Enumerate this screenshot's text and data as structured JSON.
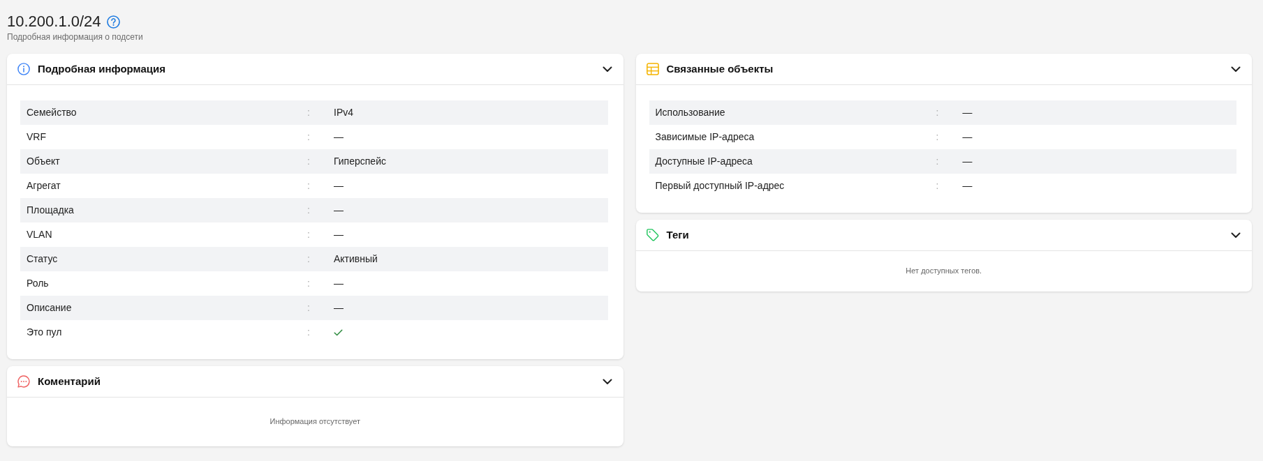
{
  "page_header": {
    "title": "10.200.1.0/24",
    "subtitle": "Подробная информация о подсети"
  },
  "left_column": [
    {
      "kind": "info",
      "title": "Подробная информация",
      "expanded": true,
      "rows": [
        {
          "label": "Семейство",
          "separator": ":",
          "kind": "text",
          "value": "IPv4"
        },
        {
          "label": "VRF",
          "separator": ":",
          "kind": "text",
          "value": "—"
        },
        {
          "label": "Объект",
          "separator": ":",
          "kind": "text",
          "value": "Гиперспейс"
        },
        {
          "label": "Агрегат",
          "separator": ":",
          "kind": "text",
          "value": "—"
        },
        {
          "label": "Площадка",
          "separator": ":",
          "kind": "text",
          "value": "—"
        },
        {
          "label": "VLAN",
          "separator": ":",
          "kind": "text",
          "value": "—"
        },
        {
          "label": "Статус",
          "separator": ":",
          "kind": "text",
          "value": "Активный"
        },
        {
          "label": "Роль",
          "separator": ":",
          "kind": "text",
          "value": "—"
        },
        {
          "label": "Описание",
          "separator": ":",
          "kind": "text",
          "value": "—"
        },
        {
          "label": "Это пул",
          "separator": ":",
          "kind": "bool",
          "checked": true
        }
      ]
    },
    {
      "kind": "comment",
      "title": "Коментарий",
      "expanded": true,
      "empty_text": "Информация отсутствует"
    }
  ],
  "right_column": [
    {
      "kind": "related",
      "title": "Связанные объекты",
      "expanded": true,
      "rows": [
        {
          "label": "Использование",
          "separator": ":",
          "kind": "text",
          "value": "—"
        },
        {
          "label": "Зависимые IP-адреса",
          "separator": ":",
          "kind": "text",
          "value": "—"
        },
        {
          "label": "Доступные IP-адреса",
          "separator": ":",
          "kind": "text",
          "value": "—"
        },
        {
          "label": "Первый доступный IP-адрес",
          "separator": ":",
          "kind": "text",
          "value": "—"
        }
      ]
    },
    {
      "kind": "tags",
      "title": "Теги",
      "expanded": true,
      "empty_text": "Нет доступных тегов."
    }
  ]
}
